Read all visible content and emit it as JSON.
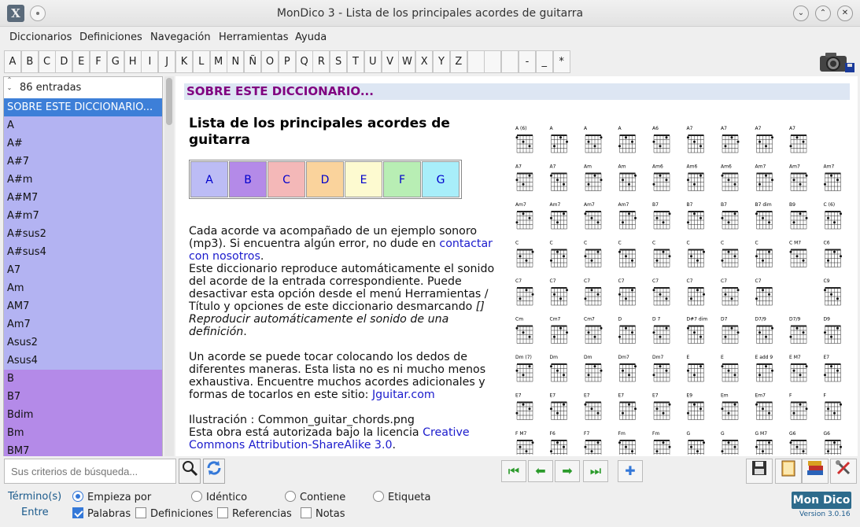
{
  "window": {
    "title": "MonDico 3 - Lista de los principales acordes de guitarra"
  },
  "menu": [
    "Diccionarios",
    "Definiciones",
    "Navegación",
    "Herramientas",
    "Ayuda"
  ],
  "alphabet": [
    "A",
    "B",
    "C",
    "D",
    "E",
    "F",
    "G",
    "H",
    "I",
    "J",
    "K",
    "L",
    "M",
    "N",
    "Ñ",
    "O",
    "P",
    "Q",
    "R",
    "S",
    "T",
    "U",
    "V",
    "W",
    "X",
    "Y",
    "Z",
    "",
    "",
    "",
    "-",
    "_",
    "*"
  ],
  "sidebar": {
    "count_label": "86 entradas",
    "items": [
      {
        "label": "SOBRE ESTE DICCIONARIO...",
        "color": "#3d7fd8",
        "text": "#ffffff"
      },
      {
        "label": "A",
        "color": "#b3b3f2"
      },
      {
        "label": "A#",
        "color": "#b3b3f2"
      },
      {
        "label": "A#7",
        "color": "#b3b3f2"
      },
      {
        "label": "A#m",
        "color": "#b3b3f2"
      },
      {
        "label": "A#M7",
        "color": "#b3b3f2"
      },
      {
        "label": "A#m7",
        "color": "#b3b3f2"
      },
      {
        "label": "A#sus2",
        "color": "#b3b3f2"
      },
      {
        "label": "A#sus4",
        "color": "#b3b3f2"
      },
      {
        "label": "A7",
        "color": "#b3b3f2"
      },
      {
        "label": "Am",
        "color": "#b3b3f2"
      },
      {
        "label": "AM7",
        "color": "#b3b3f2"
      },
      {
        "label": "Am7",
        "color": "#b3b3f2"
      },
      {
        "label": "Asus2",
        "color": "#b3b3f2"
      },
      {
        "label": "Asus4",
        "color": "#b3b3f2"
      },
      {
        "label": "B",
        "color": "#b48ae8"
      },
      {
        "label": "B7",
        "color": "#b48ae8"
      },
      {
        "label": "Bdim",
        "color": "#b48ae8"
      },
      {
        "label": "Bm",
        "color": "#b48ae8"
      },
      {
        "label": "BM7",
        "color": "#b48ae8"
      }
    ]
  },
  "content": {
    "section_heading": "SOBRE ESTE DICCIONARIO...",
    "title": "Lista de los principales acordes de guitarra",
    "color_boxes": [
      {
        "label": "A",
        "color": "#bcbcf5"
      },
      {
        "label": "B",
        "color": "#b48ae8"
      },
      {
        "label": "C",
        "color": "#f4b8b8"
      },
      {
        "label": "D",
        "color": "#fad39c"
      },
      {
        "label": "E",
        "color": "#fdfad0"
      },
      {
        "label": "F",
        "color": "#b8eeb4"
      },
      {
        "label": "G",
        "color": "#a8eefa"
      }
    ],
    "p1_a": "Cada acorde va acompañado de un ejemplo sonoro (mp3). Si encuentra algún error, no dude en ",
    "p1_link": "contactar con nosotros",
    "p1_b": ".",
    "p2": "Este diccionario reproduce automáticamente el sonido del acorde de la entrada correspondiente. Puede desactivar esta opción desde el menú Herramientas / Título y opciones de este diccionario desmarcando ",
    "p2_em": "[] Reproducir automáticamente el sonido de una definición",
    "p2_end": ".",
    "p3_a": "Un acorde se puede tocar colocando los dedos de diferentes maneras. Esta lista no es ni mucho menos exhaustiva. Encuentre muchos acordes adicionales y formas de tocarlos en este sitio: ",
    "p3_link": "Jguitar.com",
    "p4_line1": "Ilustración : Common_guitar_chords.png",
    "p4_a": "Esta obra está autorizada bajo la licencia ",
    "p4_link": "Creative Commons Attribution-ShareAlike 3.0",
    "p4_b": ".",
    "chord_rows": [
      [
        "A (6)",
        "A",
        "A",
        "A",
        "A6",
        "A7",
        "A7",
        "A7",
        "A7"
      ],
      [
        "A7",
        "A7",
        "Am",
        "Am",
        "Am6",
        "Am6",
        "Am6",
        "Am7",
        "Am7",
        "Am7"
      ],
      [
        "Am7",
        "Am7",
        "Am7",
        "Am7",
        "B7",
        "B7",
        "B7",
        "B7 dim",
        "B9",
        "C (6)"
      ],
      [
        "C",
        "C",
        "C",
        "C",
        "C",
        "C",
        "C",
        "C",
        "C M7",
        "C6"
      ],
      [
        "C7",
        "C7",
        "C7",
        "C7",
        "C7",
        "C7",
        "C7",
        "C7",
        "",
        "C9"
      ],
      [
        "Cm",
        "Cm7",
        "Cm7",
        "D",
        "D 7",
        "D#7 dim",
        "D7",
        "D7/9",
        "D7/9",
        "D9"
      ],
      [
        "Dm (7)",
        "Dm",
        "Dm",
        "Dm7",
        "Dm7",
        "E",
        "E",
        "E add 9",
        "E M7",
        "E7"
      ],
      [
        "E7",
        "E7",
        "E7",
        "E7",
        "E7",
        "E9",
        "Em",
        "Em7",
        "F",
        "F"
      ],
      [
        "F M7",
        "F6",
        "F7",
        "Fm",
        "Fm",
        "G",
        "G",
        "G M7",
        "G6",
        "G6"
      ]
    ]
  },
  "search": {
    "placeholder": "Sus criterios de búsqueda..."
  },
  "options": {
    "termino_label": "Término(s)",
    "entre_label": "Entre",
    "radios": [
      "Empieza por",
      "Idéntico",
      "Contiene",
      "Etiqueta"
    ],
    "checks": [
      "Palabras",
      "Definiciones",
      "Referencias",
      "Notas"
    ]
  },
  "brand": {
    "logo": "Mon Dico",
    "version": "Version 3.0.16"
  }
}
